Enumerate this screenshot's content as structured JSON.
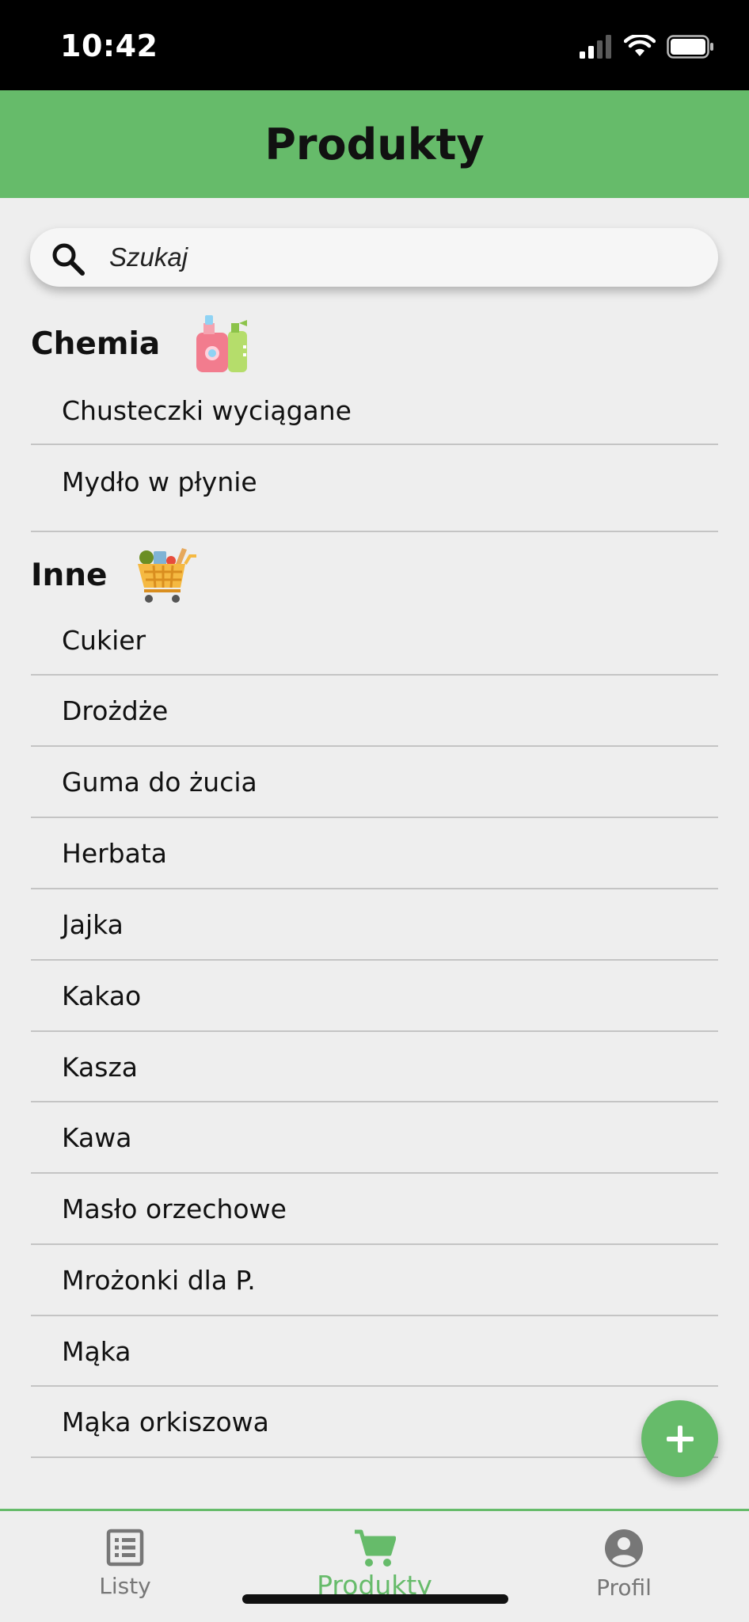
{
  "status_bar": {
    "time": "10:42"
  },
  "header": {
    "title": "Produkty"
  },
  "search": {
    "placeholder": "Szukaj"
  },
  "sections": [
    {
      "title": "Chemia",
      "icon": "cleaning-bottles-icon",
      "items": [
        "Chusteczki wyciągane",
        "Mydło w płynie"
      ]
    },
    {
      "title": "Inne",
      "icon": "shopping-cart-groceries-icon",
      "items": [
        "Cukier",
        "Drożdże",
        "Guma do żucia",
        "Herbata",
        "Jajka",
        "Kakao",
        "Kasza",
        "Kawa",
        "Masło orzechowe",
        "Mrożonki dla P.",
        "Mąka",
        "Mąka orkiszowa"
      ]
    }
  ],
  "fab": {
    "icon": "plus-icon"
  },
  "bottom_nav": {
    "items": [
      {
        "label": "Listy",
        "icon": "list-icon",
        "active": false
      },
      {
        "label": "Produkty",
        "icon": "cart-icon",
        "active": true
      },
      {
        "label": "Profil",
        "icon": "profile-icon",
        "active": false
      }
    ]
  },
  "colors": {
    "accent": "#66bb6a",
    "background": "#eeeeee",
    "divider": "#c4c4c4",
    "inactive": "#777777"
  }
}
